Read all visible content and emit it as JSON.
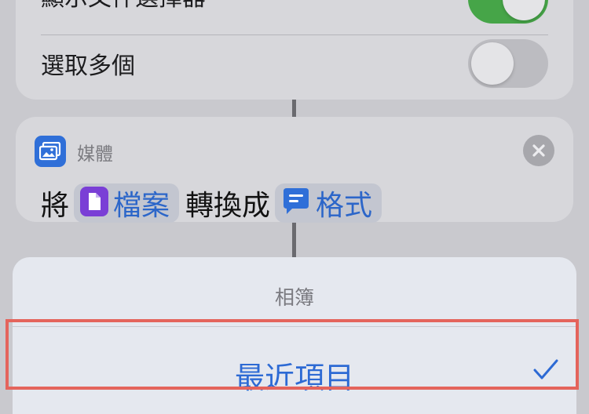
{
  "settings": {
    "show_doc_picker": {
      "label": "顯示文件選擇器",
      "state": "on"
    },
    "select_multiple": {
      "label": "選取多個",
      "state": "off"
    }
  },
  "action": {
    "category": "媒體",
    "icon": "photo-icon",
    "sentence": {
      "prefix": "將",
      "input_param": {
        "label": "檔案",
        "icon": "document-icon",
        "color": "#7a3fd6"
      },
      "middle": "轉換成",
      "output_param": {
        "label": "格式",
        "icon": "speech-bubble-icon",
        "color": "#2f6fd8"
      }
    }
  },
  "picker": {
    "title": "相簿",
    "options": [
      {
        "label": "最近項目",
        "selected": true
      }
    ]
  },
  "colors": {
    "accent": "#2d6ad4",
    "toggle_on": "#46a548",
    "highlight": "#e4645c"
  }
}
